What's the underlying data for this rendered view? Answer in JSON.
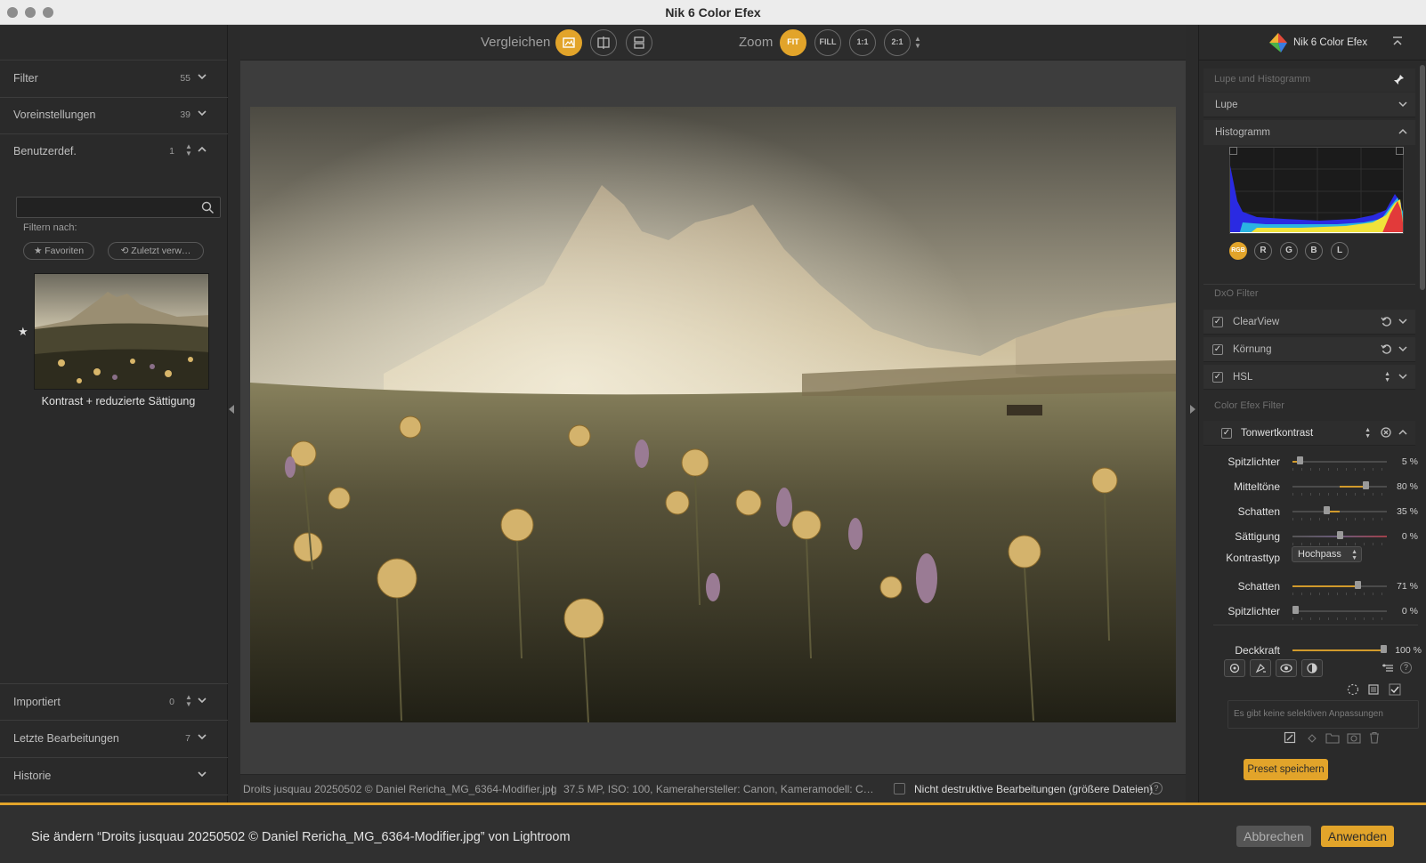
{
  "window": {
    "title": "Nik 6 Color Efex"
  },
  "left_panel": {
    "sections": [
      {
        "label": "Filter",
        "count": "55"
      },
      {
        "label": "Voreinstellungen",
        "count": "39"
      },
      {
        "label": "Benutzerdef.",
        "count": "1"
      }
    ],
    "search": {
      "placeholder": ""
    },
    "filter_by_label": "Filtern nach:",
    "favorites_label": "★ Favoriten",
    "recent_label": "⟲ Zuletzt verw…",
    "preset_thumb": {
      "label": "Kontrast + reduzierte Sättigung"
    },
    "bottom_sections": [
      {
        "label": "Importiert",
        "count": "0"
      },
      {
        "label": "Letzte Bearbeitungen",
        "count": "7"
      },
      {
        "label": "Historie",
        "count": ""
      }
    ]
  },
  "toolbar": {
    "compare_label": "Vergleichen",
    "zoom_label": "Zoom",
    "zoom_buttons": [
      "FIT",
      "FILL",
      "1:1",
      "2:1"
    ]
  },
  "status_bar": {
    "filename": "Droits jusquau 20250502 © Daniel Rericha_MG_6364-Modifier.jpg",
    "separator": "|",
    "meta": "37.5 MP, ISO: 100, Kamerahersteller: Canon, Kameramodell: C…",
    "nondestructive_label": "Nicht destruktive Bearbeitungen (größere Dateien)",
    "help": "?"
  },
  "right_panel": {
    "app_name": "Nik 6 Color Efex",
    "loupe_hist_group": "Lupe und Histogramm",
    "loupe_label": "Lupe",
    "histogram_label": "Histogramm",
    "hist_channels": [
      "RGB",
      "R",
      "G",
      "B",
      "L"
    ],
    "dxo_group": "DxO Filter",
    "dxo_filters": [
      "ClearView",
      "Körnung",
      "HSL"
    ],
    "color_efex_group": "Color Efex Filter",
    "active_filter": "Tonwertkontrast",
    "sliders": [
      {
        "label": "Spitzlichter",
        "value": "5 %",
        "level": 0.05
      },
      {
        "label": "Mitteltöne",
        "value": "80 %",
        "level": 0.8
      },
      {
        "label": "Schatten",
        "value": "35 %",
        "level": 0.35
      },
      {
        "label": "Sättigung",
        "value": "0 %",
        "level": 0.0
      }
    ],
    "contrast_type_label": "Kontrasttyp",
    "contrast_type_value": "Hochpass",
    "sliders2": [
      {
        "label": "Schatten",
        "value": "71 %",
        "level": 0.71
      },
      {
        "label": "Spitzlichter",
        "value": "0 %",
        "level": 0.0
      }
    ],
    "opacity": {
      "label": "Deckkraft",
      "value": "100 %",
      "level": 1.0
    },
    "no_selective": "Es gibt keine selektiven Anpassungen",
    "save_preset": "Preset speichern"
  },
  "bottom_bar": {
    "message": "Sie ändern “Droits jusquau 20250502 © Daniel Rericha_MG_6364-Modifier.jpg” von Lightroom",
    "cancel": "Abbrechen",
    "apply": "Anwenden"
  },
  "colors": {
    "accent": "#e2a42a",
    "panel": "#2a2a2a",
    "canvas": "#3d3d3d"
  }
}
